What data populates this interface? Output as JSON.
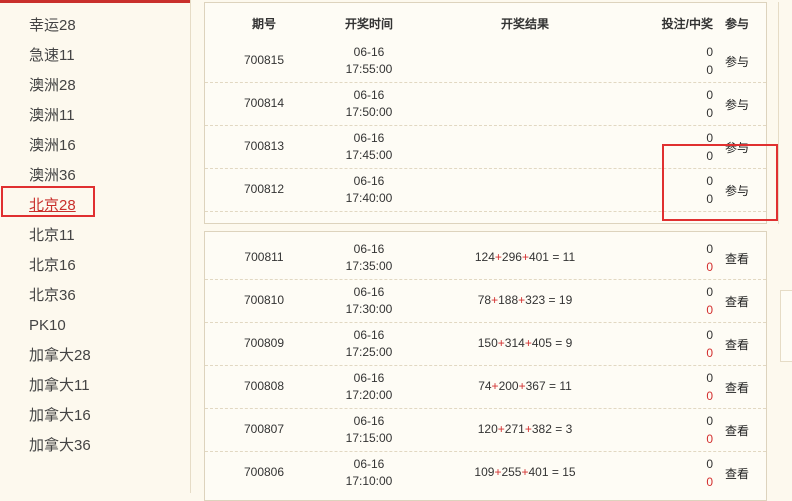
{
  "sidebar": {
    "items": [
      {
        "label": "幸运28",
        "active": false
      },
      {
        "label": "急速11",
        "active": false
      },
      {
        "label": "澳洲28",
        "active": false
      },
      {
        "label": "澳洲11",
        "active": false
      },
      {
        "label": "澳洲16",
        "active": false
      },
      {
        "label": "澳洲36",
        "active": false
      },
      {
        "label": "北京28",
        "active": true
      },
      {
        "label": "北京11",
        "active": false
      },
      {
        "label": "北京16",
        "active": false
      },
      {
        "label": "北京36",
        "active": false
      },
      {
        "label": "PK10",
        "active": false
      },
      {
        "label": "加拿大28",
        "active": false
      },
      {
        "label": "加拿大11",
        "active": false
      },
      {
        "label": "加拿大16",
        "active": false
      },
      {
        "label": "加拿大36",
        "active": false
      }
    ]
  },
  "table": {
    "headers": {
      "id": "期号",
      "time": "开奖时间",
      "result": "开奖结果",
      "bet": "投注/中奖",
      "action": "参与"
    },
    "pending": [
      {
        "id": "700815",
        "date": "06-16",
        "time": "17:55:00",
        "bet": "0",
        "win": "0",
        "action": "参与"
      },
      {
        "id": "700814",
        "date": "06-16",
        "time": "17:50:00",
        "bet": "0",
        "win": "0",
        "action": "参与"
      },
      {
        "id": "700813",
        "date": "06-16",
        "time": "17:45:00",
        "bet": "0",
        "win": "0",
        "action": "参与"
      },
      {
        "id": "700812",
        "date": "06-16",
        "time": "17:40:00",
        "bet": "0",
        "win": "0",
        "action": "参与"
      }
    ],
    "finished": [
      {
        "id": "700811",
        "date": "06-16",
        "time": "17:35:00",
        "n1": "124",
        "n2": "296",
        "n3": "401",
        "sum": "11",
        "bet": "0",
        "win": "0",
        "action": "查看"
      },
      {
        "id": "700810",
        "date": "06-16",
        "time": "17:30:00",
        "n1": "78",
        "n2": "188",
        "n3": "323",
        "sum": "19",
        "bet": "0",
        "win": "0",
        "action": "查看"
      },
      {
        "id": "700809",
        "date": "06-16",
        "time": "17:25:00",
        "n1": "150",
        "n2": "314",
        "n3": "405",
        "sum": "9",
        "bet": "0",
        "win": "0",
        "action": "查看"
      },
      {
        "id": "700808",
        "date": "06-16",
        "time": "17:20:00",
        "n1": "74",
        "n2": "200",
        "n3": "367",
        "sum": "11",
        "bet": "0",
        "win": "0",
        "action": "查看"
      },
      {
        "id": "700807",
        "date": "06-16",
        "time": "17:15:00",
        "n1": "120",
        "n2": "271",
        "n3": "382",
        "sum": "3",
        "bet": "0",
        "win": "0",
        "action": "查看"
      },
      {
        "id": "700806",
        "date": "06-16",
        "time": "17:10:00",
        "n1": "109",
        "n2": "255",
        "n3": "401",
        "sum": "15",
        "bet": "0",
        "win": "0",
        "action": "查看"
      }
    ]
  },
  "colors": {
    "accent": "#c9302c",
    "highlight": "#e03030",
    "win": "#d32f2f"
  }
}
